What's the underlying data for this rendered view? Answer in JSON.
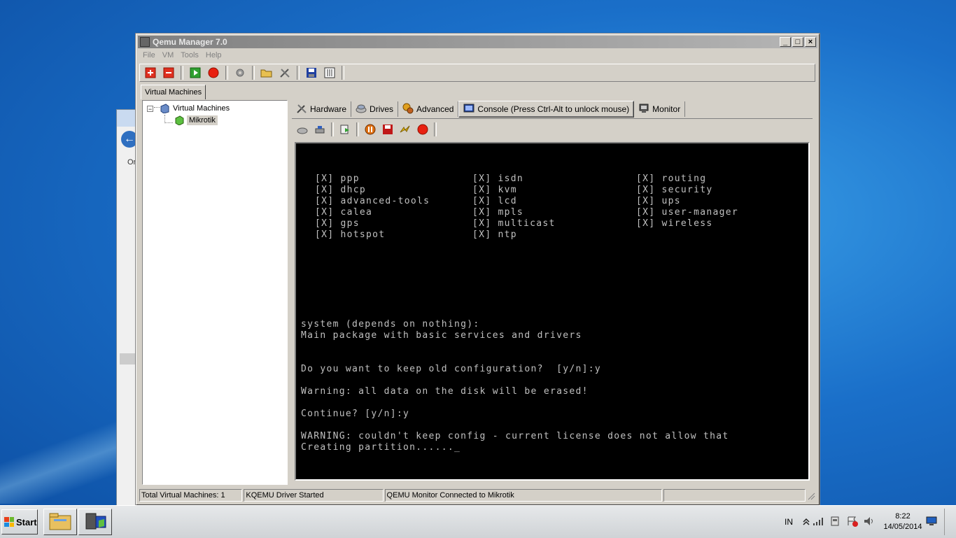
{
  "window": {
    "title": "Qemu Manager 7.0",
    "controls": [
      "_",
      "□",
      "×"
    ]
  },
  "menu": [
    "File",
    "VM",
    "Tools",
    "Help"
  ],
  "vm_tab_label": "Virtual Machines",
  "tree": {
    "root_label": "Virtual Machines",
    "expander": "−",
    "child_label": "Mikrotik"
  },
  "tabs": [
    {
      "label": "Hardware",
      "icon": "hardware-icon"
    },
    {
      "label": "Drives",
      "icon": "drives-icon"
    },
    {
      "label": "Advanced",
      "icon": "advanced-icon"
    },
    {
      "label": "Console (Press Ctrl-Alt to unlock mouse)",
      "icon": "console-icon"
    },
    {
      "label": "Monitor",
      "icon": "monitor-icon"
    }
  ],
  "console_lines": {
    "c1": [
      "[X] ppp",
      "[X] dhcp",
      "[X] advanced-tools",
      "[X] calea",
      "[X] gps",
      "[X] hotspot"
    ],
    "c2": [
      "[X] isdn",
      "[X] kvm",
      "[X] lcd",
      "[X] mpls",
      "[X] multicast",
      "[X] ntp"
    ],
    "c3": [
      "[X] routing",
      "[X] security",
      "[X] ups",
      "[X] user-manager",
      "[X] wireless"
    ],
    "l1": "system (depends on nothing):",
    "l2": "Main package with basic services and drivers",
    "l3": "Do you want to keep old configuration?  [y/n]:y",
    "l4": "Warning: all data on the disk will be erased!",
    "l5": "Continue? [y/n]:y",
    "l6": "WARNING: couldn't keep config - current license does not allow that",
    "l7": "Creating partition......_"
  },
  "status": {
    "total": "Total Virtual Machines: 1",
    "driver": "KQEMU Driver Started",
    "monitor": "QEMU Monitor Connected to Mikrotik"
  },
  "background_window": {
    "back_glyph": "←",
    "label": "Or"
  },
  "taskbar": {
    "start_label": "Start",
    "language": "IN",
    "time": "8:22",
    "date": "14/05/2014"
  },
  "colors": {
    "desktop": "#1a6fc9",
    "console_bg": "#000000",
    "console_text": "#c0c0c0",
    "window_face": "#d4d0c8"
  }
}
